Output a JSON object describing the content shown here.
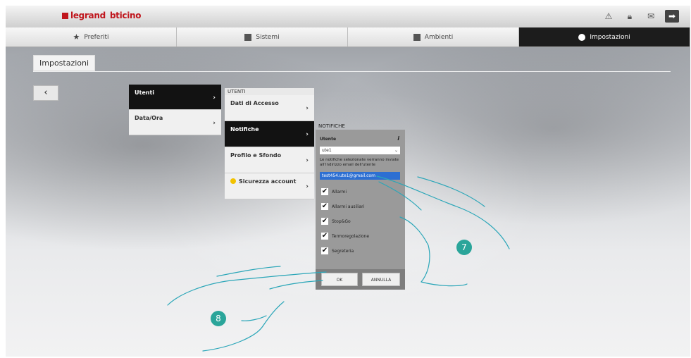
{
  "header": {
    "logo_part1": "legrand",
    "logo_part2": "bticino"
  },
  "nav": {
    "tabs": [
      {
        "label": "Preferiti",
        "icon": "star-icon"
      },
      {
        "label": "Sistemi",
        "icon": "system-icon"
      },
      {
        "label": "Ambienti",
        "icon": "rooms-icon"
      },
      {
        "label": "Impostazioni",
        "icon": "settings-icon"
      }
    ]
  },
  "page": {
    "title": "Impostazioni",
    "back_label": "‹"
  },
  "menu1": {
    "items": [
      {
        "label": "Utenti"
      },
      {
        "label": "Data/Ora"
      }
    ]
  },
  "menu2": {
    "heading": "UTENTI",
    "items": [
      {
        "label": "Dati di Accesso"
      },
      {
        "label": "Notifiche"
      },
      {
        "label": "Profilo e Sfondo"
      },
      {
        "label": "Sicurezza account"
      }
    ]
  },
  "notifiche": {
    "heading": "NOTIFICHE",
    "utente_label": "Utente",
    "utente_value": "ute1",
    "description": "Le notifiche selezionate verranno inviate all'indirizzo email dell'utente",
    "email": "test454.ute1@gmail.com",
    "checkboxes": [
      {
        "label": "Allarmi",
        "checked": true
      },
      {
        "label": "Allarmi ausiliari",
        "checked": true
      },
      {
        "label": "Stop&Go",
        "checked": true
      },
      {
        "label": "Termoregolazione",
        "checked": true
      },
      {
        "label": "Segreteria",
        "checked": true
      }
    ],
    "ok_label": "OK",
    "cancel_label": "ANNULLA"
  },
  "callouts": {
    "step7": "7",
    "step8": "8"
  }
}
